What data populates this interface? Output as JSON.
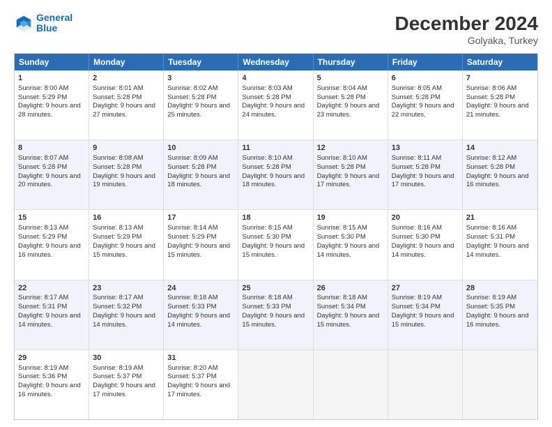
{
  "header": {
    "logo_line1": "General",
    "logo_line2": "Blue",
    "month": "December 2024",
    "location": "Golyaka, Turkey"
  },
  "weekdays": [
    "Sunday",
    "Monday",
    "Tuesday",
    "Wednesday",
    "Thursday",
    "Friday",
    "Saturday"
  ],
  "rows": [
    [
      {
        "day": "1",
        "sunrise": "Sunrise: 8:00 AM",
        "sunset": "Sunset: 5:29 PM",
        "daylight": "Daylight: 9 hours and 28 minutes."
      },
      {
        "day": "2",
        "sunrise": "Sunrise: 8:01 AM",
        "sunset": "Sunset: 5:28 PM",
        "daylight": "Daylight: 9 hours and 27 minutes."
      },
      {
        "day": "3",
        "sunrise": "Sunrise: 8:02 AM",
        "sunset": "Sunset: 5:28 PM",
        "daylight": "Daylight: 9 hours and 25 minutes."
      },
      {
        "day": "4",
        "sunrise": "Sunrise: 8:03 AM",
        "sunset": "Sunset: 5:28 PM",
        "daylight": "Daylight: 9 hours and 24 minutes."
      },
      {
        "day": "5",
        "sunrise": "Sunrise: 8:04 AM",
        "sunset": "Sunset: 5:28 PM",
        "daylight": "Daylight: 9 hours and 23 minutes."
      },
      {
        "day": "6",
        "sunrise": "Sunrise: 8:05 AM",
        "sunset": "Sunset: 5:28 PM",
        "daylight": "Daylight: 9 hours and 22 minutes."
      },
      {
        "day": "7",
        "sunrise": "Sunrise: 8:06 AM",
        "sunset": "Sunset: 5:28 PM",
        "daylight": "Daylight: 9 hours and 21 minutes."
      }
    ],
    [
      {
        "day": "8",
        "sunrise": "Sunrise: 8:07 AM",
        "sunset": "Sunset: 5:28 PM",
        "daylight": "Daylight: 9 hours and 20 minutes."
      },
      {
        "day": "9",
        "sunrise": "Sunrise: 8:08 AM",
        "sunset": "Sunset: 5:28 PM",
        "daylight": "Daylight: 9 hours and 19 minutes."
      },
      {
        "day": "10",
        "sunrise": "Sunrise: 8:09 AM",
        "sunset": "Sunset: 5:28 PM",
        "daylight": "Daylight: 9 hours and 18 minutes."
      },
      {
        "day": "11",
        "sunrise": "Sunrise: 8:10 AM",
        "sunset": "Sunset: 5:28 PM",
        "daylight": "Daylight: 9 hours and 18 minutes."
      },
      {
        "day": "12",
        "sunrise": "Sunrise: 8:10 AM",
        "sunset": "Sunset: 5:28 PM",
        "daylight": "Daylight: 9 hours and 17 minutes."
      },
      {
        "day": "13",
        "sunrise": "Sunrise: 8:11 AM",
        "sunset": "Sunset: 5:28 PM",
        "daylight": "Daylight: 9 hours and 17 minutes."
      },
      {
        "day": "14",
        "sunrise": "Sunrise: 8:12 AM",
        "sunset": "Sunset: 5:28 PM",
        "daylight": "Daylight: 9 hours and 16 minutes."
      }
    ],
    [
      {
        "day": "15",
        "sunrise": "Sunrise: 8:13 AM",
        "sunset": "Sunset: 5:29 PM",
        "daylight": "Daylight: 9 hours and 16 minutes."
      },
      {
        "day": "16",
        "sunrise": "Sunrise: 8:13 AM",
        "sunset": "Sunset: 5:29 PM",
        "daylight": "Daylight: 9 hours and 15 minutes."
      },
      {
        "day": "17",
        "sunrise": "Sunrise: 8:14 AM",
        "sunset": "Sunset: 5:29 PM",
        "daylight": "Daylight: 9 hours and 15 minutes."
      },
      {
        "day": "18",
        "sunrise": "Sunrise: 8:15 AM",
        "sunset": "Sunset: 5:30 PM",
        "daylight": "Daylight: 9 hours and 15 minutes."
      },
      {
        "day": "19",
        "sunrise": "Sunrise: 8:15 AM",
        "sunset": "Sunset: 5:30 PM",
        "daylight": "Daylight: 9 hours and 14 minutes."
      },
      {
        "day": "20",
        "sunrise": "Sunrise: 8:16 AM",
        "sunset": "Sunset: 5:30 PM",
        "daylight": "Daylight: 9 hours and 14 minutes."
      },
      {
        "day": "21",
        "sunrise": "Sunrise: 8:16 AM",
        "sunset": "Sunset: 5:31 PM",
        "daylight": "Daylight: 9 hours and 14 minutes."
      }
    ],
    [
      {
        "day": "22",
        "sunrise": "Sunrise: 8:17 AM",
        "sunset": "Sunset: 5:31 PM",
        "daylight": "Daylight: 9 hours and 14 minutes."
      },
      {
        "day": "23",
        "sunrise": "Sunrise: 8:17 AM",
        "sunset": "Sunset: 5:32 PM",
        "daylight": "Daylight: 9 hours and 14 minutes."
      },
      {
        "day": "24",
        "sunrise": "Sunrise: 8:18 AM",
        "sunset": "Sunset: 5:33 PM",
        "daylight": "Daylight: 9 hours and 14 minutes."
      },
      {
        "day": "25",
        "sunrise": "Sunrise: 8:18 AM",
        "sunset": "Sunset: 5:33 PM",
        "daylight": "Daylight: 9 hours and 15 minutes."
      },
      {
        "day": "26",
        "sunrise": "Sunrise: 8:18 AM",
        "sunset": "Sunset: 5:34 PM",
        "daylight": "Daylight: 9 hours and 15 minutes."
      },
      {
        "day": "27",
        "sunrise": "Sunrise: 8:19 AM",
        "sunset": "Sunset: 5:34 PM",
        "daylight": "Daylight: 9 hours and 15 minutes."
      },
      {
        "day": "28",
        "sunrise": "Sunrise: 8:19 AM",
        "sunset": "Sunset: 5:35 PM",
        "daylight": "Daylight: 9 hours and 16 minutes."
      }
    ],
    [
      {
        "day": "29",
        "sunrise": "Sunrise: 8:19 AM",
        "sunset": "Sunset: 5:36 PM",
        "daylight": "Daylight: 9 hours and 16 minutes."
      },
      {
        "day": "30",
        "sunrise": "Sunrise: 8:19 AM",
        "sunset": "Sunset: 5:37 PM",
        "daylight": "Daylight: 9 hours and 17 minutes."
      },
      {
        "day": "31",
        "sunrise": "Sunrise: 8:20 AM",
        "sunset": "Sunset: 5:37 PM",
        "daylight": "Daylight: 9 hours and 17 minutes."
      },
      null,
      null,
      null,
      null
    ]
  ]
}
